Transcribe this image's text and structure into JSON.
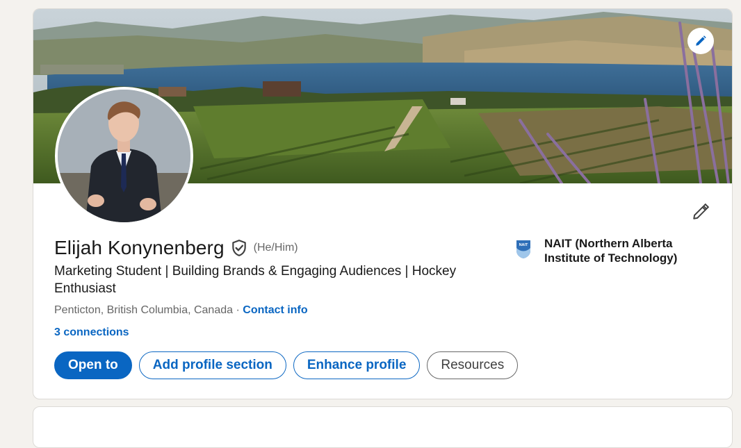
{
  "profile": {
    "name": "Elijah Konynenberg",
    "pronouns": "(He/Him)",
    "headline": "Marketing Student | Building Brands & Engaging Audiences | Hockey Enthusiast",
    "location": "Penticton, British Columbia, Canada",
    "separator": "·",
    "contact_info": "Contact info",
    "connections": "3 connections"
  },
  "actions": {
    "open_to": "Open to",
    "add_profile_section": "Add profile section",
    "enhance_profile": "Enhance profile",
    "resources": "Resources"
  },
  "education": {
    "logo_text": "NAIT",
    "school": "NAIT (Northern Alberta Institute of Technology)"
  },
  "icons": {
    "banner_edit": "pencil-icon",
    "intro_edit": "pencil-icon",
    "verified": "shield-check-icon"
  },
  "colors": {
    "accent": "#0a66c2",
    "muted_text": "#666666",
    "background": "#f4f2ee"
  }
}
